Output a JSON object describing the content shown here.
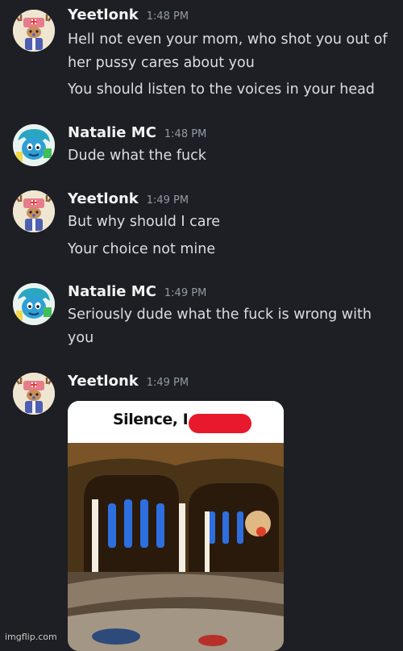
{
  "messages": [
    {
      "user": "Yeetlonk",
      "time": "1:48 PM",
      "avatar_icon": "chopper-avatar-icon",
      "lines": [
        "Hell not even your mom, who shot you out of",
        "her pussy cares about you",
        "You should listen to the voices in your head"
      ]
    },
    {
      "user": "Natalie MC",
      "time": "1:48 PM",
      "avatar_icon": "blue-creature-avatar-icon",
      "lines": [
        "Dude what the fuck"
      ]
    },
    {
      "user": "Yeetlonk",
      "time": "1:49 PM",
      "avatar_icon": "chopper-avatar-icon",
      "lines": [
        "But why should I care",
        "Your choice not mine"
      ]
    },
    {
      "user": "Natalie MC",
      "time": "1:49 PM",
      "avatar_icon": "blue-creature-avatar-icon",
      "lines": [
        "Seriously dude what the fuck is wrong with",
        "you"
      ]
    },
    {
      "user": "Yeetlonk",
      "time": "1:49 PM",
      "avatar_icon": "chopper-avatar-icon",
      "attachment": {
        "caption": "Silence, I",
        "redacted": true
      }
    }
  ],
  "watermark": "imgflip.com",
  "colors": {
    "background": "#1e1f24",
    "username": "#f2f3f5",
    "text": "#dbdee1",
    "timestamp": "#949ba4",
    "redaction": "#e8192c"
  }
}
